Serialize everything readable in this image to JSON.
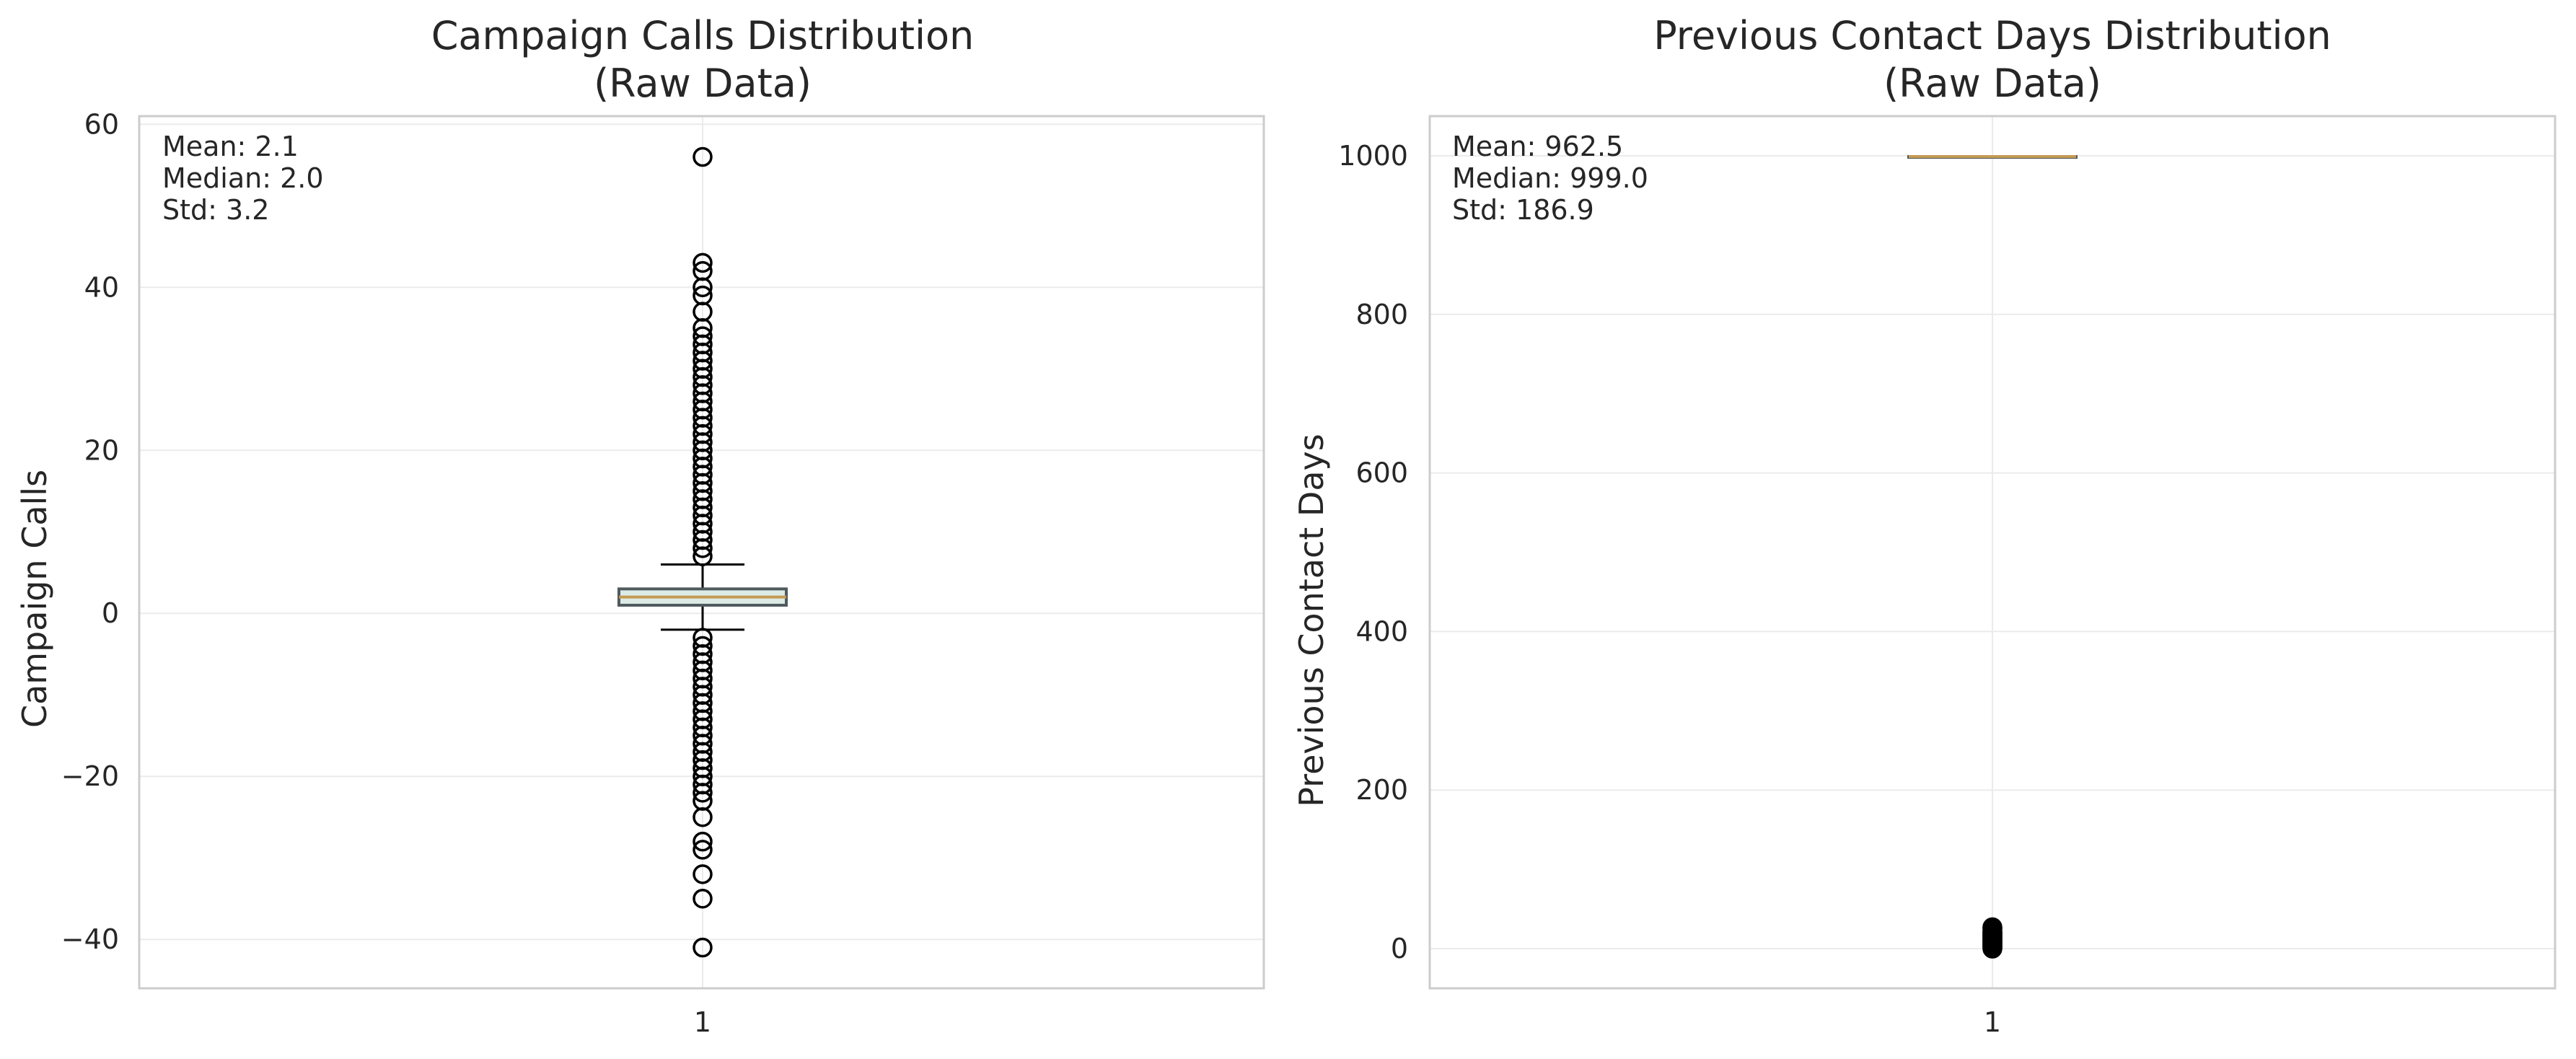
{
  "chart_data": [
    {
      "type": "box",
      "title": "Campaign Calls Distribution\n(Raw Data)",
      "xlabel": "",
      "ylabel": "Campaign Calls",
      "categories": [
        "1"
      ],
      "ylim": [
        -46,
        61
      ],
      "yticks": [
        -40,
        -20,
        0,
        20,
        40,
        60
      ],
      "ytick_labels": [
        "−40",
        "−20",
        "0",
        "20",
        "40",
        "60"
      ],
      "grid": true,
      "box": {
        "q1": 1,
        "median": 2,
        "q3": 3,
        "whisker_low": -2,
        "whisker_high": 6
      },
      "box_fill": "#dcebe5",
      "box_edge": "#4f5a5f",
      "median_color": "#c49a53",
      "outliers": [
        7,
        8,
        9,
        10,
        11,
        12,
        13,
        14,
        15,
        16,
        17,
        18,
        19,
        20,
        21,
        22,
        23,
        24,
        25,
        26,
        27,
        28,
        29,
        30,
        31,
        32,
        33,
        34,
        35,
        37,
        39,
        40,
        42,
        43,
        56,
        -3,
        -4,
        -5,
        -6,
        -7,
        -8,
        -9,
        -10,
        -11,
        -12,
        -13,
        -14,
        -15,
        -16,
        -17,
        -18,
        -19,
        -20,
        -21,
        -22,
        -23,
        -25,
        -28,
        -29,
        -32,
        -35,
        -41
      ],
      "stats_text": [
        "Mean: 2.1",
        "Median: 2.0",
        "Std: 3.2"
      ]
    },
    {
      "type": "box",
      "title": "Previous Contact Days Distribution\n(Raw Data)",
      "xlabel": "",
      "ylabel": "Previous Contact Days",
      "categories": [
        "1"
      ],
      "ylim": [
        -50,
        1050
      ],
      "yticks": [
        0,
        200,
        400,
        600,
        800,
        1000
      ],
      "ytick_labels": [
        "0",
        "200",
        "400",
        "600",
        "800",
        "1000"
      ],
      "grid": true,
      "box": {
        "q1": 999,
        "median": 999,
        "q3": 999,
        "whisker_low": 999,
        "whisker_high": 999
      },
      "box_fill": "#dcebe5",
      "box_edge": "#4f5a5f",
      "median_color": "#c49a53",
      "outliers": [
        0,
        1,
        2,
        3,
        4,
        5,
        6,
        7,
        8,
        9,
        10,
        11,
        12,
        13,
        14,
        15,
        16,
        17,
        18,
        19,
        20,
        21,
        22,
        25,
        26,
        27
      ],
      "stats_text": [
        "Mean: 962.5",
        "Median: 999.0",
        "Std: 186.9"
      ]
    }
  ]
}
